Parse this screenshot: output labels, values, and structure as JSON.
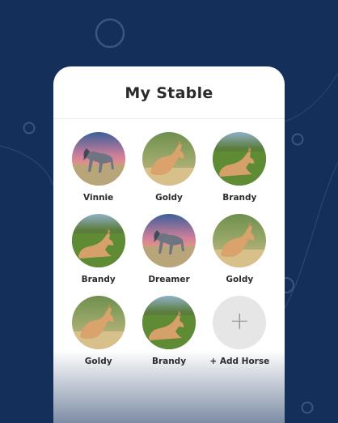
{
  "page": {
    "title": "My Stable"
  },
  "horses": [
    {
      "name": "Vinnie",
      "photo": "grey-horse-sunset"
    },
    {
      "name": "Goldy",
      "photo": "palomino-foal-field"
    },
    {
      "name": "Brandy",
      "photo": "palomino-foal-lying-grass"
    },
    {
      "name": "Brandy",
      "photo": "palomino-foal-lying-grass"
    },
    {
      "name": "Dreamer",
      "photo": "grey-horse-sunset"
    },
    {
      "name": "Goldy",
      "photo": "palomino-foal-field"
    },
    {
      "name": "Goldy",
      "photo": "palomino-foal-field"
    },
    {
      "name": "Brandy",
      "photo": "palomino-foal-lying-grass"
    }
  ],
  "add_horse": {
    "label": "+ Add Horse",
    "icon": "plus-icon"
  },
  "colors": {
    "background": "#14305a",
    "card": "#ffffff",
    "text": "#2b2b2b",
    "add_circle": "#e6e6e6"
  }
}
